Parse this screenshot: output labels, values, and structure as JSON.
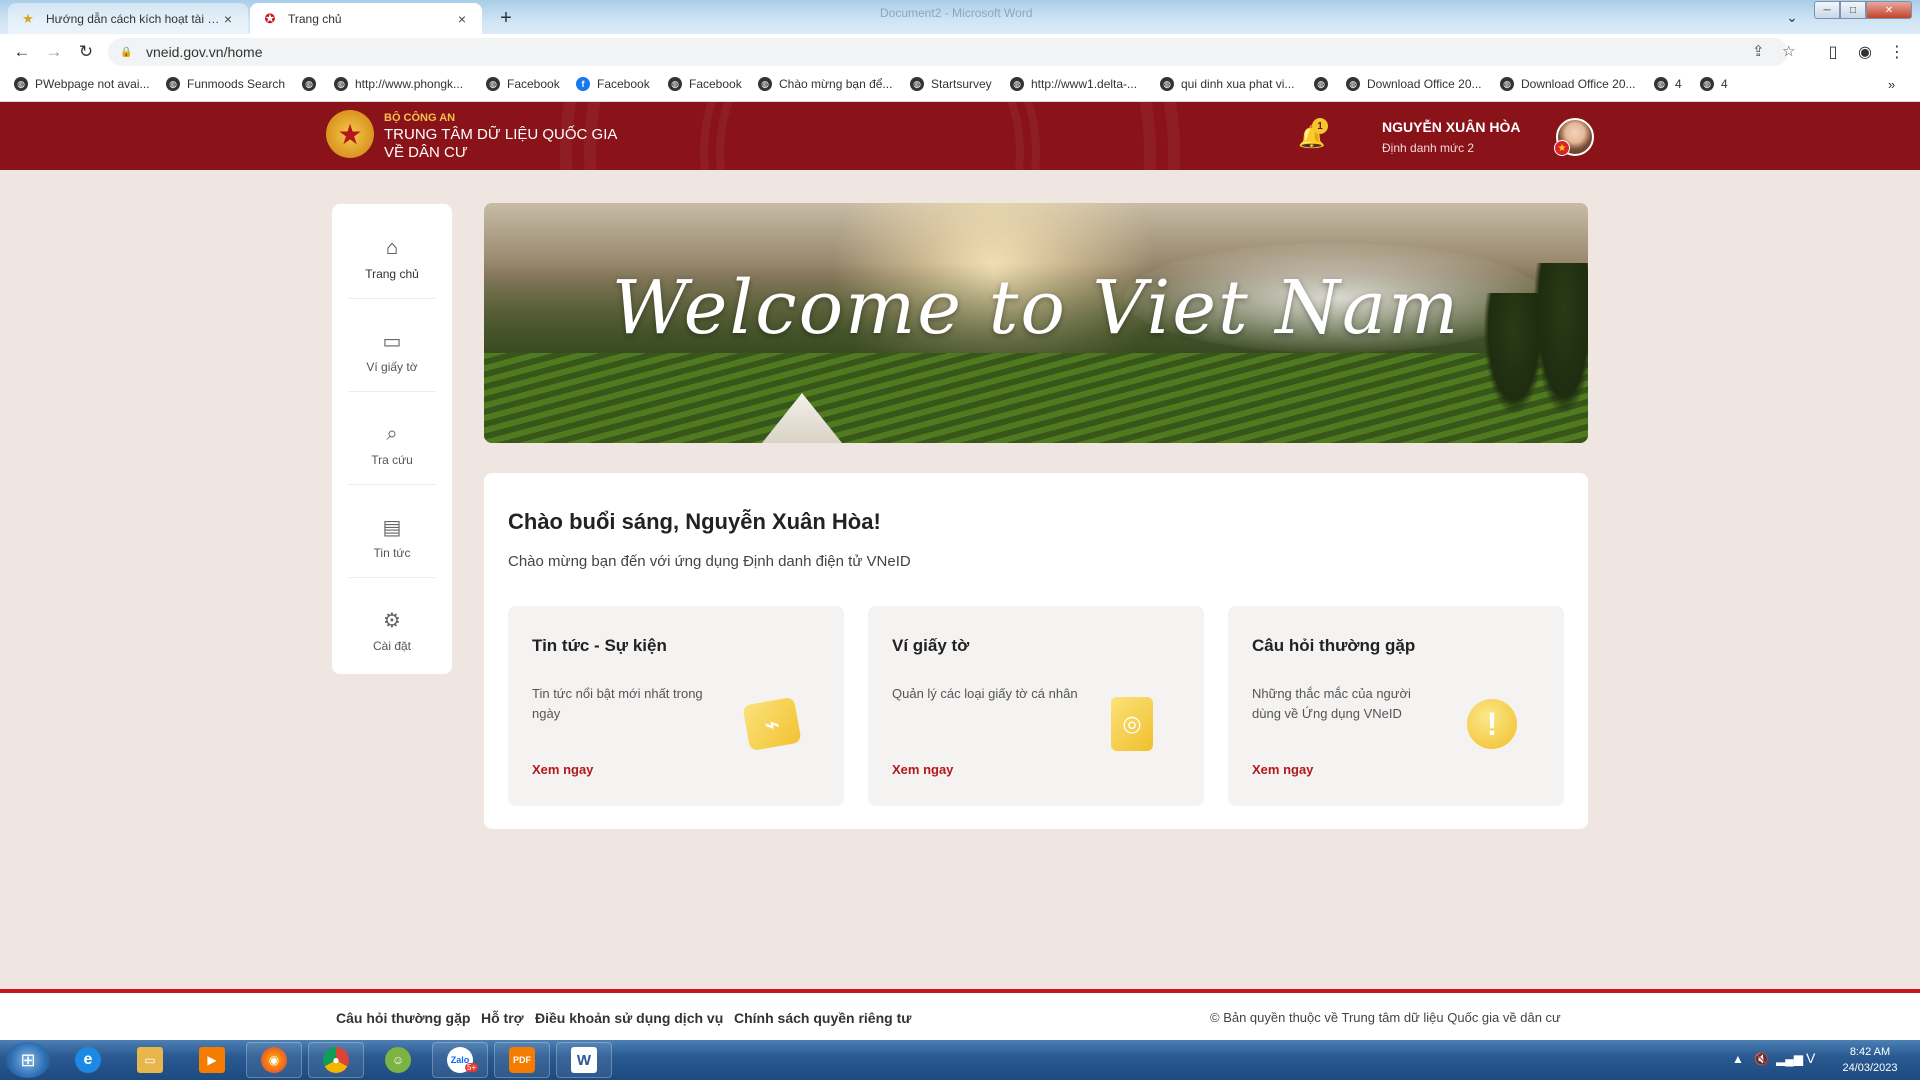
{
  "browser": {
    "tabs": [
      {
        "title": "Hướng dẫn cách kích hoạt tài khoản",
        "active": false
      },
      {
        "title": "Trang chủ",
        "active": true
      }
    ],
    "new_tab_symbol": "+",
    "window_title": "Document2 - Microsoft Word",
    "url": "vneid.gov.vn/home",
    "bookmarks": [
      {
        "label": "PWebpage not avai...",
        "icon": "globe-icon"
      },
      {
        "label": "Funmoods Search",
        "icon": "globe-icon"
      },
      {
        "label": "",
        "icon": "globe-icon"
      },
      {
        "label": "http://www.phongk...",
        "icon": "globe-icon"
      },
      {
        "label": "Facebook",
        "icon": "globe-icon"
      },
      {
        "label": "Facebook",
        "icon": "facebook-icon"
      },
      {
        "label": "Facebook",
        "icon": "globe-icon"
      },
      {
        "label": "Chào mừng bạn để...",
        "icon": "globe-icon"
      },
      {
        "label": "Startsurvey",
        "icon": "globe-icon"
      },
      {
        "label": "http://www1.delta-...",
        "icon": "globe-icon"
      },
      {
        "label": "qui dinh xua phat vi...",
        "icon": "globe-icon"
      },
      {
        "label": "",
        "icon": "globe-icon"
      },
      {
        "label": "Download Office 20...",
        "icon": "globe-icon"
      },
      {
        "label": "Download Office 20...",
        "icon": "globe-icon"
      },
      {
        "label": "4",
        "icon": "globe-icon"
      },
      {
        "label": "4",
        "icon": "globe-icon"
      }
    ]
  },
  "header": {
    "org_line1": "BỘ CÔNG AN",
    "org_line2": "TRUNG TÂM DỮ LIỆU QUỐC GIA",
    "org_line3": "VỀ DÂN CƯ",
    "notification_count": "1",
    "user_name": "NGUYỄN XUÂN HÒA",
    "user_level": "Định danh mức 2"
  },
  "sidebar": {
    "items": [
      {
        "label": "Trang chủ",
        "icon": "home-icon",
        "active": true
      },
      {
        "label": "Ví giấy tờ",
        "icon": "wallet-icon",
        "active": false
      },
      {
        "label": "Tra cứu",
        "icon": "search-icon",
        "active": false
      },
      {
        "label": "Tin tức",
        "icon": "news-icon",
        "active": false
      },
      {
        "label": "Cài đặt",
        "icon": "gear-icon",
        "active": false
      }
    ]
  },
  "banner": {
    "text": "Welcome to Viet Nam"
  },
  "main": {
    "greeting": "Chào buổi sáng, Nguyễn Xuân Hòa!",
    "subtitle": "Chào mừng bạn đến với ứng dụng Định danh điện tử VNeID",
    "features": [
      {
        "title": "Tin tức - Sự kiện",
        "desc": "Tin tức nổi bật mới nhất trong ngày",
        "link": "Xem ngay",
        "icon": "news-chart-icon"
      },
      {
        "title": "Ví giấy tờ",
        "desc": "Quản lý các loại giấy tờ cá nhân",
        "link": "Xem ngay",
        "icon": "passport-icon"
      },
      {
        "title": "Câu hỏi thường gặp",
        "desc": "Những thắc mắc của người dùng về Ứng dụng VNeID",
        "link": "Xem ngay",
        "icon": "exclamation-icon"
      }
    ]
  },
  "footer": {
    "links": [
      "Câu hỏi thường gặp",
      "Hỗ trợ",
      "Điều khoản sử dụng dịch vụ",
      "Chính sách quyền riêng tư"
    ],
    "copyright": "© Bản quyền thuộc về Trung tâm dữ liệu Quốc gia về dân cư"
  },
  "taskbar": {
    "apps": [
      "internet-explorer",
      "file-explorer",
      "media-player",
      "firefox",
      "chrome",
      "coccoc",
      "zalo",
      "foxit-pdf",
      "word"
    ],
    "zalo_label": "Zalo",
    "zalo_badge": "5+",
    "pdf_label": "PDF",
    "word_label": "W",
    "tray_language": "V",
    "time": "8:42 AM",
    "date": "24/03/2023"
  },
  "colors": {
    "header_bg": "#8a1219",
    "accent_red": "#b3161d",
    "badge_yellow": "#f5c62e",
    "page_bg": "#f0e6e1"
  }
}
